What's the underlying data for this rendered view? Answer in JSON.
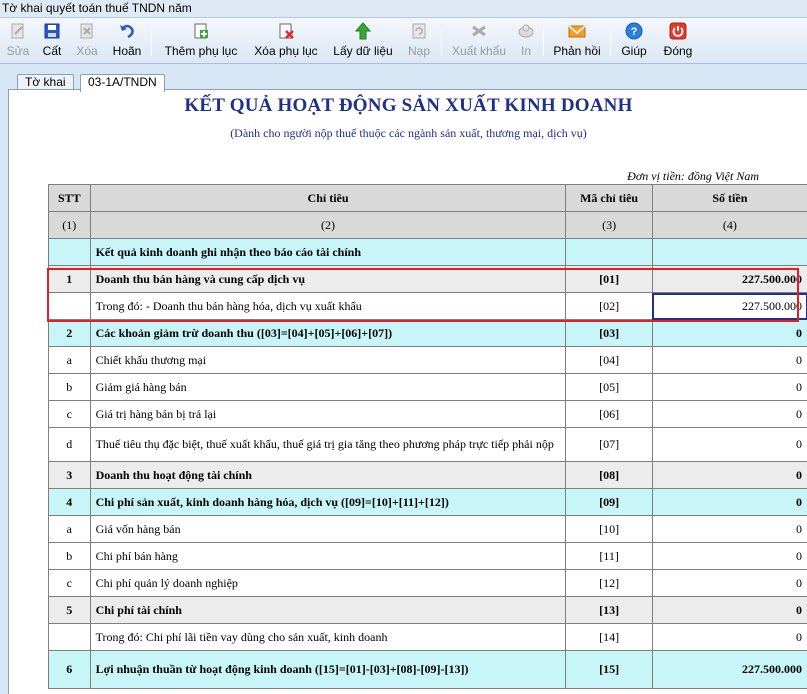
{
  "window": {
    "title": "Tờ khai quyết toán thuế TNDN năm"
  },
  "toolbar": {
    "buttons": [
      {
        "label": "Sửa",
        "icon": "edit-icon",
        "enabled": false
      },
      {
        "label": "Cất",
        "icon": "save-icon",
        "enabled": true
      },
      {
        "label": "Xóa",
        "icon": "delete-icon",
        "enabled": false
      },
      {
        "label": "Hoãn",
        "icon": "undo-icon",
        "enabled": true
      },
      {
        "label": "Thêm phụ lục",
        "icon": "add-appendix-icon",
        "enabled": true
      },
      {
        "label": "Xóa phụ lục",
        "icon": "remove-appendix-icon",
        "enabled": true
      },
      {
        "label": "Lấy dữ liệu",
        "icon": "get-data-icon",
        "enabled": true
      },
      {
        "label": "Nạp",
        "icon": "load-icon",
        "enabled": false
      },
      {
        "label": "Xuất khẩu",
        "icon": "export-icon",
        "enabled": false
      },
      {
        "label": "In",
        "icon": "print-icon",
        "enabled": false
      },
      {
        "label": "Phản hồi",
        "icon": "feedback-icon",
        "enabled": true
      },
      {
        "label": "Giúp",
        "icon": "help-icon",
        "enabled": true
      },
      {
        "label": "Đóng",
        "icon": "close-icon",
        "enabled": true
      }
    ]
  },
  "tabs": [
    {
      "label": "Tờ khai",
      "active": false
    },
    {
      "label": "03-1A/TNDN",
      "active": true
    }
  ],
  "report": {
    "title": "KẾT QUẢ HOẠT ĐỘNG SẢN XUẤT KINH DOANH",
    "subtitle": "(Dành cho người nộp thuế thuộc các ngành sản xuất, thương mại, dịch vụ)",
    "unit": "Đơn vị tiền: đồng Việt Nam",
    "headers": {
      "stt": "STT",
      "indicator": "Chỉ tiêu",
      "code": "Mã chỉ tiêu",
      "amount": "Số tiền"
    },
    "column_numbers": {
      "c1": "(1)",
      "c2": "(2)",
      "c3": "(3)",
      "c4": "(4)"
    },
    "rows": [
      {
        "stt": "",
        "label": "Kết  quả  kinh doanh ghi nhận theo báo cáo tài chính",
        "code": "",
        "amount": ""
      },
      {
        "stt": "1",
        "label": "Doanh thu bán hàng và cung cấp dịch vụ",
        "code": "[01]",
        "amount": "227.500.000"
      },
      {
        "stt": "",
        "label": "Trong đó: - Doanh thu bán hàng hóa, dịch vụ xuất khẩu",
        "code": "[02]",
        "amount": "227.500.000"
      },
      {
        "stt": "2",
        "label": "Các khoản giảm trừ doanh thu ([03]=[04]+[05]+[06]+[07])",
        "code": "[03]",
        "amount": "0"
      },
      {
        "stt": "a",
        "label": "Chiết khấu thương mại",
        "code": "[04]",
        "amount": "0"
      },
      {
        "stt": "b",
        "label": "Giảm giá hàng bán",
        "code": "[05]",
        "amount": "0"
      },
      {
        "stt": "c",
        "label": "Giá trị hàng bán bị trả lại",
        "code": "[06]",
        "amount": "0"
      },
      {
        "stt": "d",
        "label": "Thuế tiêu thụ đặc biệt, thuế xuất khẩu, thuế giá trị gia tăng theo phương pháp trực tiếp phải nộp",
        "code": "[07]",
        "amount": "0"
      },
      {
        "stt": "3",
        "label": "Doanh thu hoạt động tài chính",
        "code": "[08]",
        "amount": "0"
      },
      {
        "stt": "4",
        "label": "Chi phí sản xuất, kinh doanh hàng hóa, dịch vụ ([09]=[10]+[11]+[12])",
        "code": "[09]",
        "amount": "0"
      },
      {
        "stt": "a",
        "label": "Giá vốn hàng bán",
        "code": "[10]",
        "amount": "0"
      },
      {
        "stt": "b",
        "label": "Chi phí bán hàng",
        "code": "[11]",
        "amount": "0"
      },
      {
        "stt": "c",
        "label": "Chi phí quản lý doanh nghiệp",
        "code": "[12]",
        "amount": "0"
      },
      {
        "stt": "5",
        "label": "Chi phí tài chính",
        "code": "[13]",
        "amount": "0"
      },
      {
        "stt": "",
        "label": "Trong đó: Chi phí lãi tiền vay dùng cho sản xuất, kinh doanh",
        "code": "[14]",
        "amount": "0"
      },
      {
        "stt": "6",
        "label": "Lợi nhuận thuần từ hoạt động kinh doanh  ([15]=[01]-[03]+[08]-[09]-[13])",
        "code": "[15]",
        "amount": "227.500.000"
      }
    ]
  },
  "colors": {
    "accent": "#1f2f8a",
    "highlight_border": "#e41e25",
    "cyan_row": "#c8f6f8",
    "gray_row": "#ececec"
  }
}
